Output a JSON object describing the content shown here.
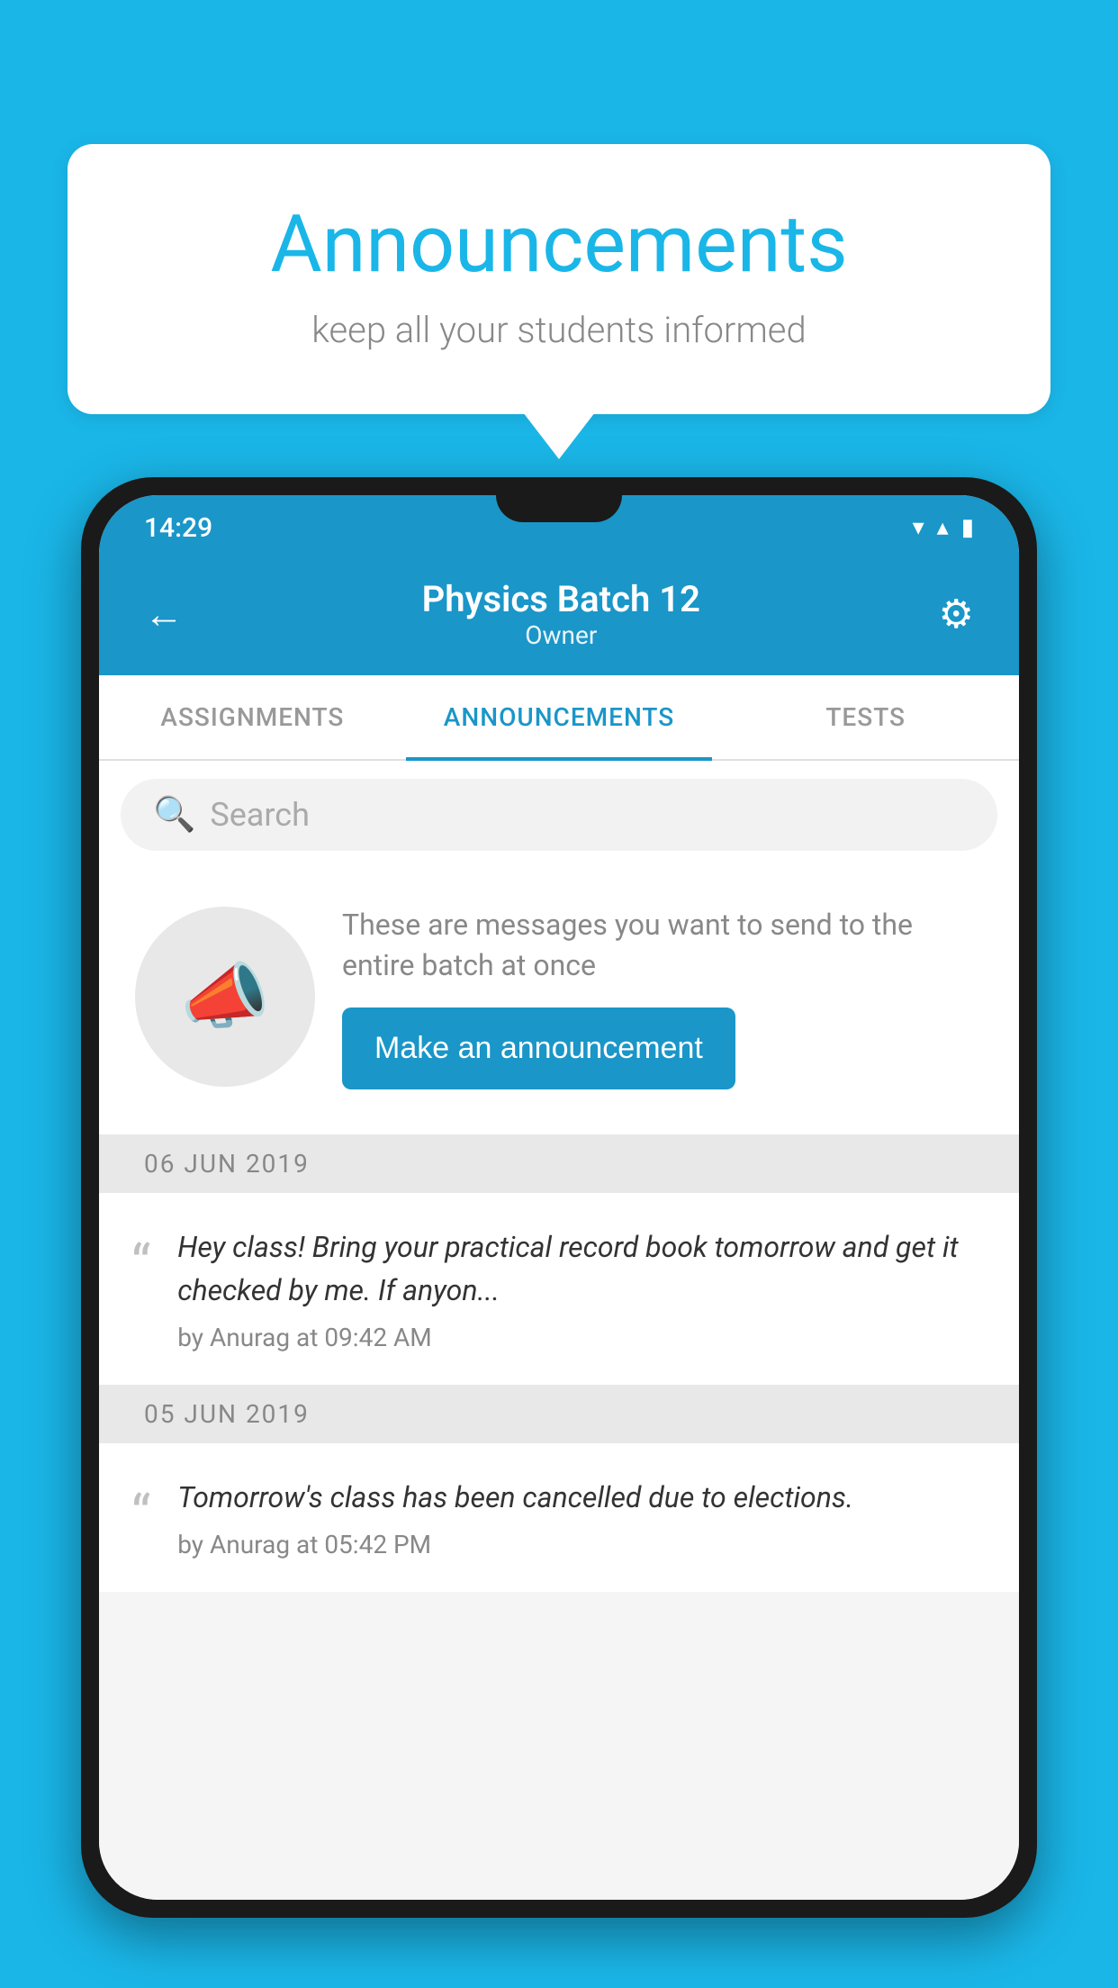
{
  "background_color": "#1ab6e8",
  "speech_bubble": {
    "title": "Announcements",
    "subtitle": "keep all your students informed"
  },
  "status_bar": {
    "time": "14:29",
    "wifi": "▼",
    "signal": "▲",
    "battery": "▮"
  },
  "app_header": {
    "title": "Physics Batch 12",
    "subtitle": "Owner",
    "back_label": "←",
    "gear_label": "⚙"
  },
  "tabs": [
    {
      "label": "ASSIGNMENTS",
      "active": false
    },
    {
      "label": "ANNOUNCEMENTS",
      "active": true
    },
    {
      "label": "TESTS",
      "active": false
    }
  ],
  "search": {
    "placeholder": "Search"
  },
  "promo_card": {
    "description": "These are messages you want to send to the entire batch at once",
    "button_label": "Make an announcement"
  },
  "announcements": [
    {
      "date": "06  JUN  2019",
      "text": "Hey class! Bring your practical record book tomorrow and get it checked by me. If anyon...",
      "meta": "by Anurag at 09:42 AM"
    },
    {
      "date": "05  JUN  2019",
      "text": "Tomorrow's class has been cancelled due to elections.",
      "meta": "by Anurag at 05:42 PM"
    }
  ]
}
